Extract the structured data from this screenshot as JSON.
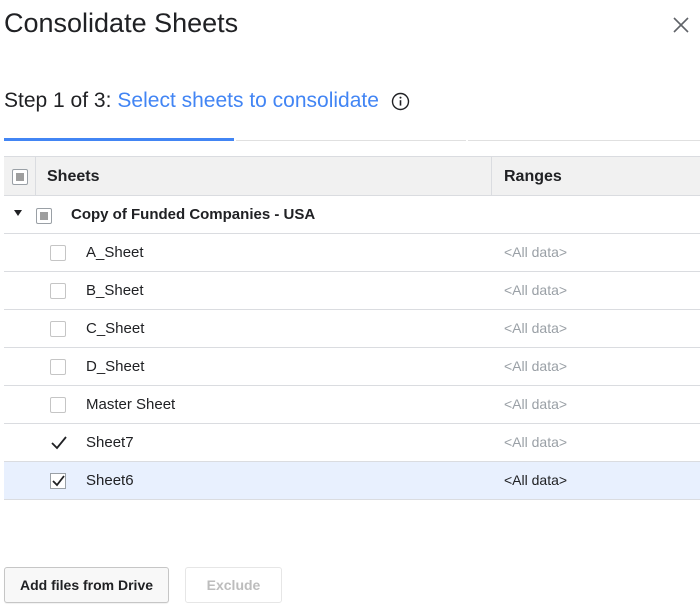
{
  "dialog": {
    "title": "Consolidate Sheets",
    "close_icon": "close-icon"
  },
  "step": {
    "prefix": "Step 1 of 3:",
    "label": "Select sheets to consolidate",
    "info_icon": "info-icon",
    "accent_color": "#4285f4"
  },
  "table": {
    "headers": {
      "sheets": "Sheets",
      "ranges": "Ranges"
    },
    "header_checkbox": "partial",
    "group": {
      "name": "Copy of Funded Companies - USA",
      "expanded": true,
      "checkbox": "partial"
    },
    "rows": [
      {
        "name": "A_Sheet",
        "range": "<All data>",
        "checked": false,
        "selected": false
      },
      {
        "name": "B_Sheet",
        "range": "<All data>",
        "checked": false,
        "selected": false
      },
      {
        "name": "C_Sheet",
        "range": "<All data>",
        "checked": false,
        "selected": false
      },
      {
        "name": "D_Sheet",
        "range": "<All data>",
        "checked": false,
        "selected": false
      },
      {
        "name": "Master Sheet",
        "range": "<All data>",
        "checked": false,
        "selected": false
      },
      {
        "name": "Sheet7",
        "range": "<All data>",
        "checked": true,
        "selected": false
      },
      {
        "name": "Sheet6",
        "range": "<All data>",
        "checked": true,
        "selected": true
      }
    ],
    "selected_row_color": "#e8f0fe"
  },
  "footer": {
    "add_files_label": "Add files from Drive",
    "exclude_label": "Exclude",
    "exclude_enabled": false
  }
}
